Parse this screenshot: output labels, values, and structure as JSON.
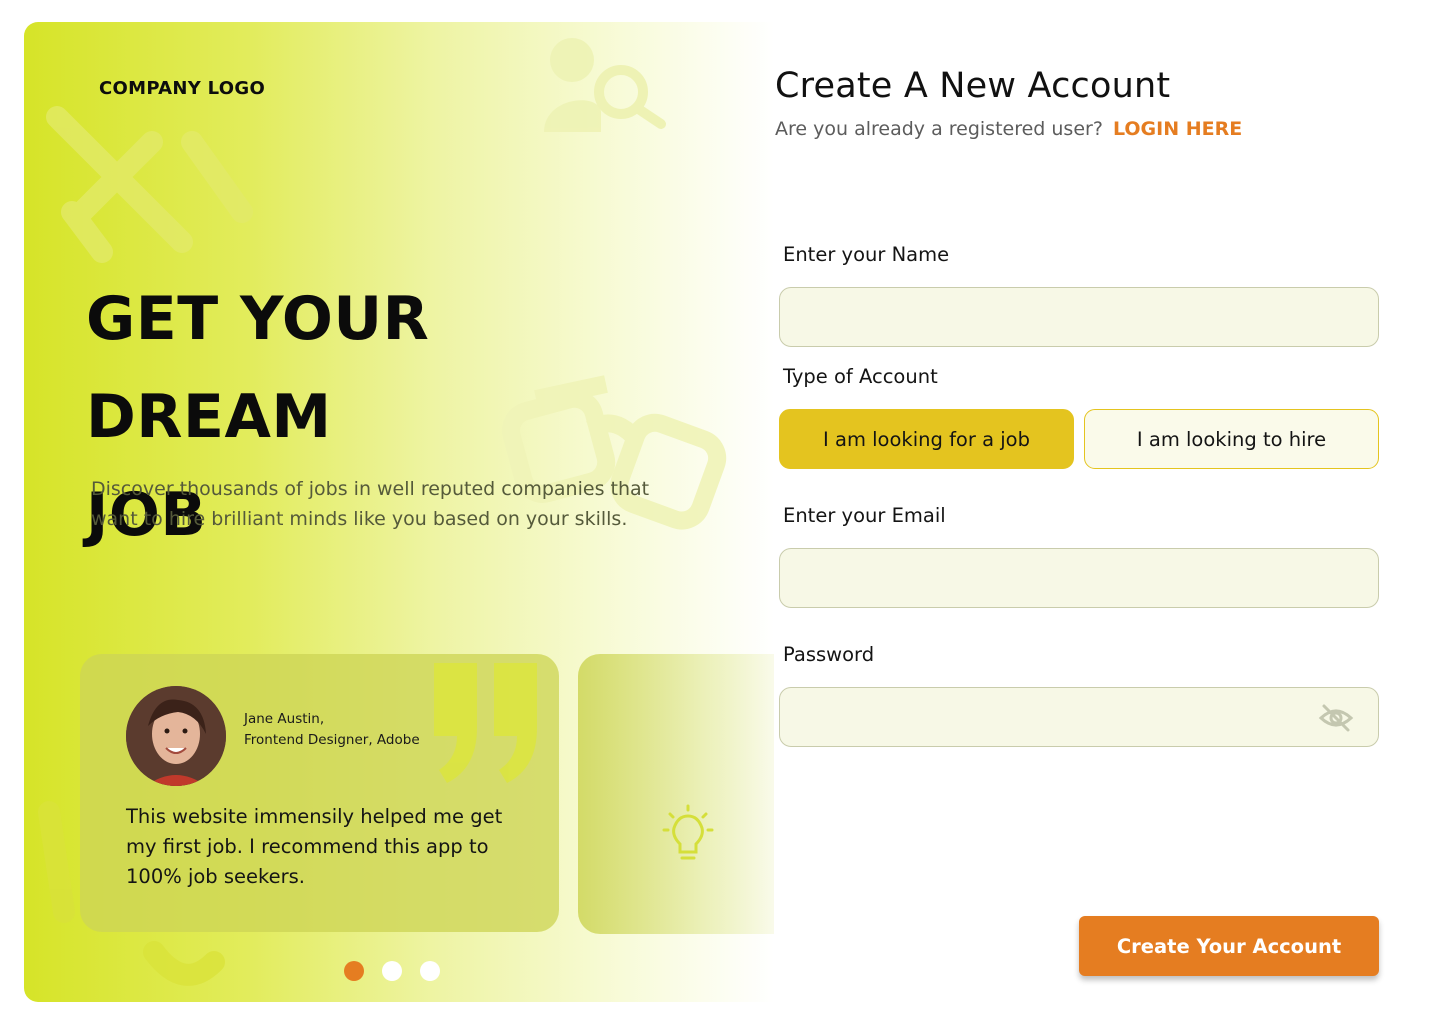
{
  "hero": {
    "logo": "COMPANY LOGO",
    "headline_line1": "GET YOUR DREAM",
    "headline_line2": "JOB",
    "description": "Discover thousands of jobs in well reputed companies that want to hire brilliant minds like you based on your skills.",
    "testimonial": {
      "author_name": "Jane Austin,",
      "author_role": "Frontend Designer, Adobe",
      "quote": "This website immensily helped me get my first job. I recommend this app to 100% job seekers."
    },
    "carousel": {
      "slide_count": 3,
      "active_index": 0
    }
  },
  "form": {
    "title": "Create A New Account",
    "subtitle": "Are you already a registered user?",
    "login_link": "LOGIN HERE",
    "name_label": "Enter your Name",
    "name_value": "",
    "account_type_label": "Type of Account",
    "account_options": [
      "I am looking for a job",
      "I am looking to hire"
    ],
    "selected_account_option": "I am looking for a job",
    "email_label": "Enter your Email",
    "email_value": "",
    "password_label": "Password",
    "password_value": "",
    "submit_label": "Create Your Account"
  },
  "colors": {
    "accent": "#e57d21",
    "hero_green": "#d6e428",
    "selected_option": "#e4c41f",
    "field_bg": "#f7f8e6"
  },
  "icons": [
    "user-search-icon",
    "handshake-icon",
    "glasses-icon",
    "quote-icon",
    "lightbulb-icon",
    "eye-slash-icon"
  ]
}
